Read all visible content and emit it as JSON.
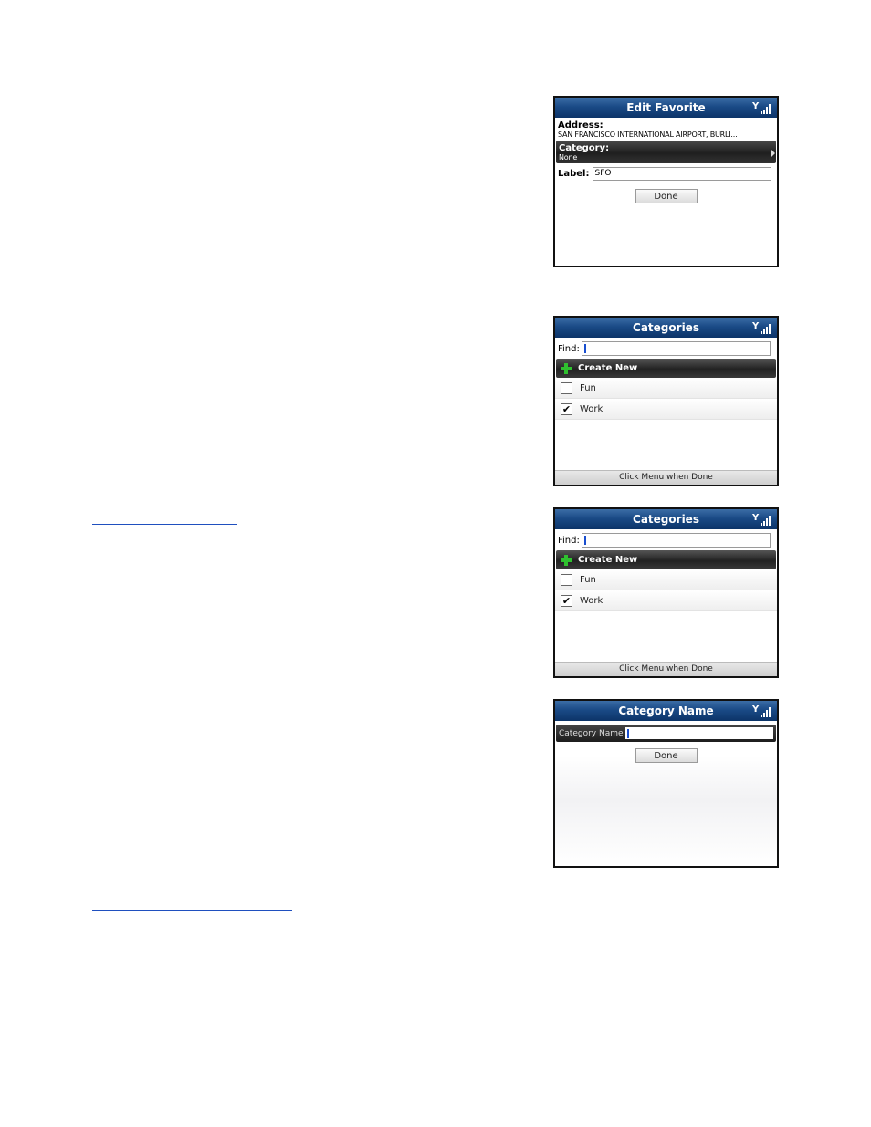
{
  "screen1": {
    "title": "Edit Favorite",
    "address_label": "Address:",
    "address_value": "SAN FRANCISCO INTERNATIONAL AIRPORT, BURLI...",
    "category_label": "Category:",
    "category_value": "None",
    "label_label": "Label:",
    "label_value": "SFO",
    "done_label": "Done"
  },
  "screen2": {
    "title": "Categories",
    "find_label": "Find:",
    "create_label": "Create New",
    "items": [
      {
        "label": "Fun",
        "checked": false
      },
      {
        "label": "Work",
        "checked": true
      }
    ],
    "footer": "Click Menu when Done"
  },
  "screen3": {
    "title": "Categories",
    "find_label": "Find:",
    "create_label": "Create New",
    "items": [
      {
        "label": "Fun",
        "checked": false
      },
      {
        "label": "Work",
        "checked": true
      }
    ],
    "footer": "Click Menu when Done"
  },
  "screen4": {
    "title": "Category Name",
    "name_label": "Category Name",
    "done_label": "Done"
  },
  "icons": {
    "signal": "signal-strength-icon",
    "add": "plus-icon",
    "check": "checkmark-icon"
  },
  "colors": {
    "title_bar": "#1a4a86",
    "add_icon": "#2fc12f",
    "cursor": "#1a4fd0"
  }
}
